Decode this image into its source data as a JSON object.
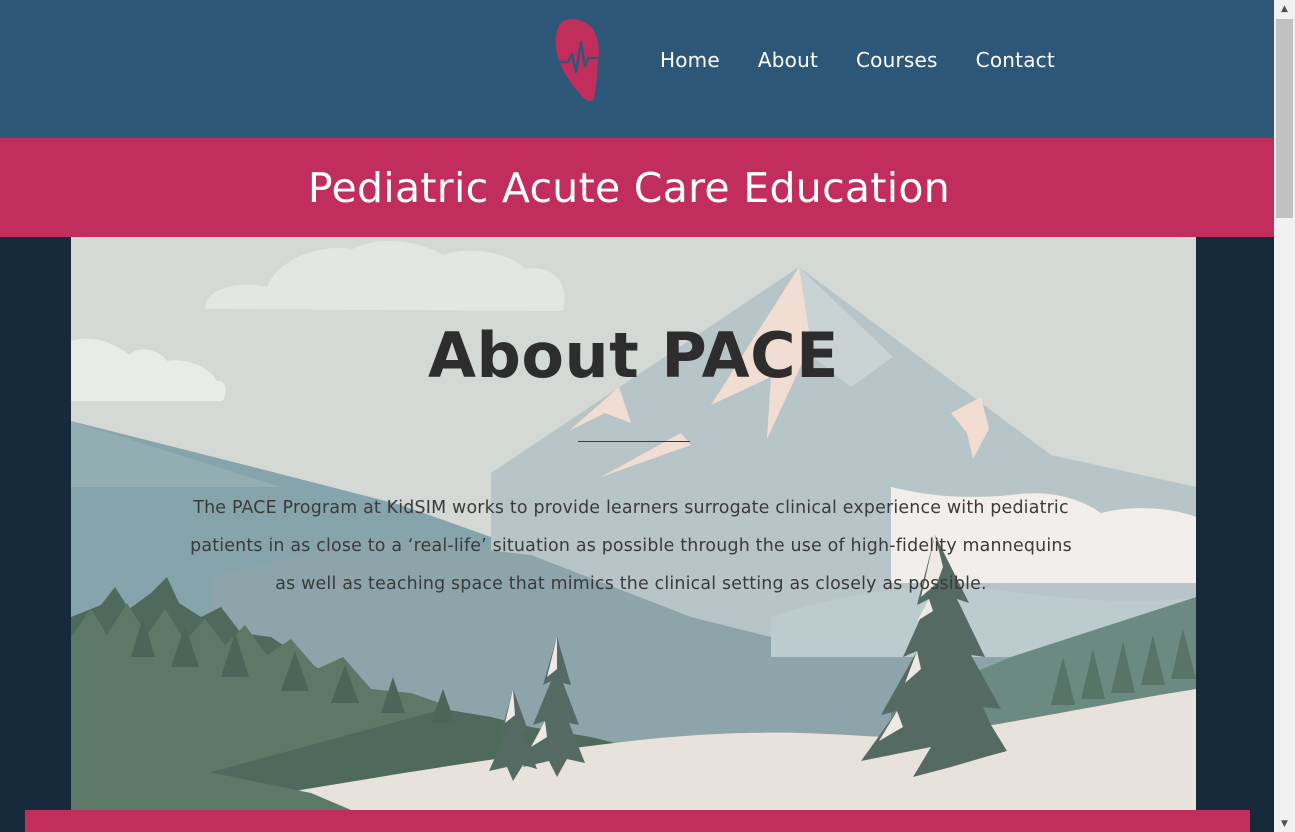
{
  "header": {
    "logo_icon": "heart-pulse-icon",
    "nav": [
      {
        "label": "Home"
      },
      {
        "label": "About"
      },
      {
        "label": "Courses"
      },
      {
        "label": "Contact"
      }
    ]
  },
  "banner": {
    "title": "Pediatric Acute Care Education"
  },
  "hero": {
    "title": "About PACE",
    "description": "The PACE Program at KidSIM works to provide learners surrogate clinical experience with pediatric patients in as close to a ‘real-life’ situation as possible through the use of high-fidelity mannequins as well as teaching space that mimics the clinical setting as closely as possible."
  },
  "colors": {
    "header_bg": "#2c5779",
    "banner_bg": "#c22e5b",
    "page_bg": "#162a3b",
    "logo": "#c22e5b"
  }
}
